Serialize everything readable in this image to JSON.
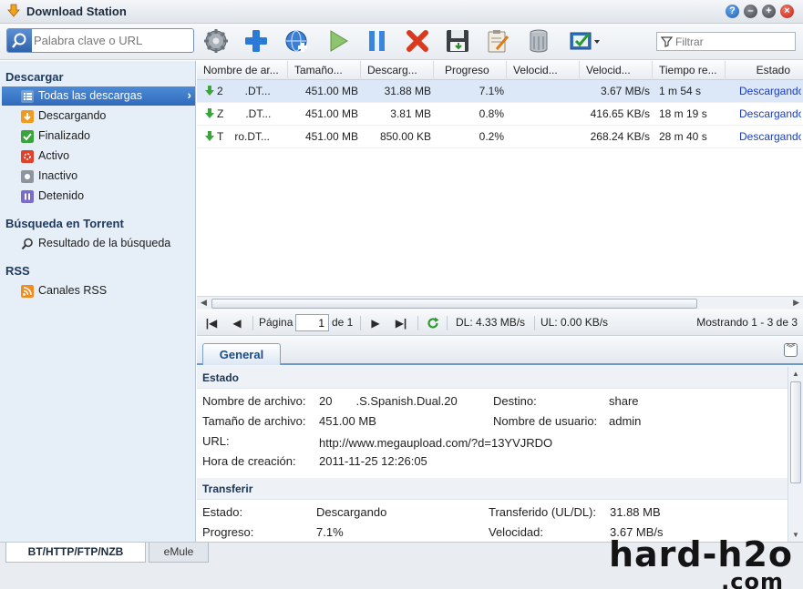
{
  "window": {
    "title": "Download Station"
  },
  "toolbar": {
    "search_placeholder": "Palabra clave o URL",
    "filter_placeholder": "Filtrar"
  },
  "sidebar": {
    "sections": [
      {
        "title": "Descargar"
      },
      {
        "title": "Búsqueda en Torrent"
      },
      {
        "title": "RSS"
      }
    ],
    "items": [
      {
        "label": "Todas las descargas",
        "icon": "list-icon"
      },
      {
        "label": "Descargando",
        "icon": "downloading-icon"
      },
      {
        "label": "Finalizado",
        "icon": "check-icon"
      },
      {
        "label": "Activo",
        "icon": "active-icon"
      },
      {
        "label": "Inactivo",
        "icon": "inactive-icon"
      },
      {
        "label": "Detenido",
        "icon": "pause-icon"
      },
      {
        "label": "Resultado de la búsqueda",
        "icon": "magnifier-icon"
      },
      {
        "label": "Canales RSS",
        "icon": "rss-icon"
      }
    ]
  },
  "grid": {
    "columns": [
      "Nombre de ar...",
      "Tamaño...",
      "Descarg...",
      "Progreso",
      "Velocid...",
      "Velocid...",
      "Tiempo re...",
      "Estado"
    ],
    "rows": [
      {
        "name": "2    .DT...",
        "size": "451.00 MB",
        "downloaded": "31.88 MB",
        "progress": "7.1%",
        "upload_speed": "",
        "download_speed": "3.67 MB/s",
        "time_left": "1 m 54 s",
        "status": "Descargando"
      },
      {
        "name": "Z    .DT...",
        "size": "451.00 MB",
        "downloaded": "3.81 MB",
        "progress": "0.8%",
        "upload_speed": "",
        "download_speed": "416.65 KB/s",
        "time_left": "18 m 19 s",
        "status": "Descargando"
      },
      {
        "name": "T  ro.DT...",
        "size": "451.00 MB",
        "downloaded": "850.00 KB",
        "progress": "0.2%",
        "upload_speed": "",
        "download_speed": "268.24 KB/s",
        "time_left": "28 m 40 s",
        "status": "Descargando"
      }
    ]
  },
  "pager": {
    "page_label": "Página",
    "page_value": "1",
    "of_label": "de 1",
    "dl": "DL: 4.33 MB/s",
    "ul": "UL: 0.00 KB/s",
    "showing": "Mostrando 1 - 3 de 3"
  },
  "detail": {
    "tab": "General",
    "estado_title": "Estado",
    "transfer_title": "Transferir",
    "fields": {
      "filename_label": "Nombre de archivo:",
      "filename_value": "20    .S.Spanish.Dual.20",
      "dest_label": "Destino:",
      "dest_value": "share",
      "size_label": "Tamaño de archivo:",
      "size_value": "451.00 MB",
      "user_label": "Nombre de usuario:",
      "user_value": "admin",
      "url_label": "URL:",
      "url_value": "http://www.megaupload.com/?d=13YVJRDO",
      "created_label": "Hora de creación:",
      "created_value": "2011-11-25 12:26:05",
      "state_label": "Estado:",
      "state_value": "Descargando",
      "transferred_label": "Transferido (UL/DL):",
      "transferred_value": "31.88 MB",
      "progress_label": "Progreso:",
      "progress_value": "7.1%",
      "speed_label": "Velocidad:",
      "speed_value": "3.67 MB/s"
    }
  },
  "bottom_tabs": [
    "BT/HTTP/FTP/NZB",
    "eMule"
  ],
  "watermark": {
    "line1": "hard-h2o",
    "line2": ".com"
  },
  "colors": {
    "accent": "#2f6bbb",
    "status_link": "#1a3cc4",
    "selected_row": "#dce8f7"
  }
}
